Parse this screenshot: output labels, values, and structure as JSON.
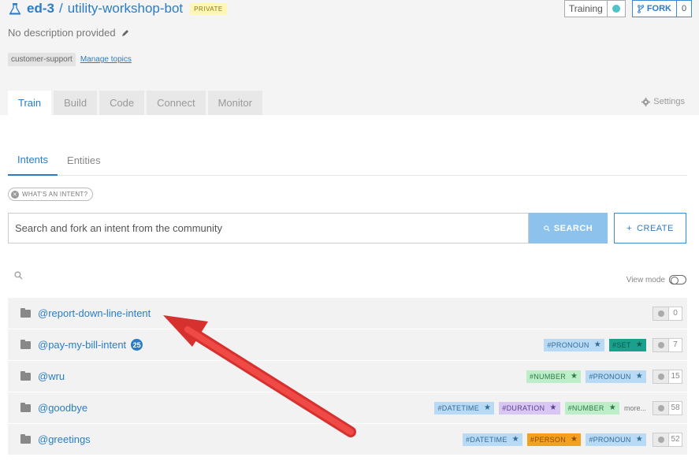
{
  "header": {
    "owner": "ed-3",
    "slash": "/",
    "repo": "utility-workshop-bot",
    "private_badge": "PRIVATE",
    "description": "No description provided",
    "topic": "customer-support",
    "manage_topics": "Manage topics",
    "training_label": "Training",
    "fork_label": "FORK",
    "fork_count": "0"
  },
  "tabs": [
    {
      "label": "Train",
      "active": true
    },
    {
      "label": "Build"
    },
    {
      "label": "Code"
    },
    {
      "label": "Connect"
    },
    {
      "label": "Monitor"
    }
  ],
  "settings_label": "Settings",
  "subtabs": [
    {
      "label": "Intents",
      "active": true
    },
    {
      "label": "Entities"
    }
  ],
  "help_pill": "WHAT'S AN INTENT?",
  "search": {
    "value": "Search and fork an intent from the community",
    "button": "SEARCH",
    "create": "CREATE"
  },
  "view_mode_label": "View mode",
  "intents": [
    {
      "name": "@report-down-line-intent",
      "badge": "",
      "tags": [],
      "more": "",
      "count": "0"
    },
    {
      "name": "@pay-my-bill-intent",
      "badge": "25",
      "tags": [
        {
          "text": "#PRONOUN",
          "color": "blue"
        },
        {
          "text": "#SET",
          "color": "teal"
        }
      ],
      "more": "",
      "count": "7"
    },
    {
      "name": "@wru",
      "badge": "",
      "tags": [
        {
          "text": "#NUMBER",
          "color": "green"
        },
        {
          "text": "#PRONOUN",
          "color": "blue"
        }
      ],
      "more": "",
      "count": "15"
    },
    {
      "name": "@goodbye",
      "badge": "",
      "tags": [
        {
          "text": "#DATETIME",
          "color": "blue"
        },
        {
          "text": "#DURATION",
          "color": "purple"
        },
        {
          "text": "#NUMBER",
          "color": "green"
        }
      ],
      "more": "more...",
      "count": "58"
    },
    {
      "name": "@greetings",
      "badge": "",
      "tags": [
        {
          "text": "#DATETIME",
          "color": "blue"
        },
        {
          "text": "#PERSON",
          "color": "orange"
        },
        {
          "text": "#PRONOUN",
          "color": "blue"
        }
      ],
      "more": "",
      "count": "52"
    }
  ],
  "colors": {
    "accent": "#2a7cc7",
    "arrow": "#e8393a",
    "search_button": "#8cc2ec"
  },
  "icons": [
    "bot-icon",
    "pencil-icon",
    "fork-icon",
    "gear-icon",
    "search-icon",
    "plus-icon",
    "folder-icon",
    "filter-icon",
    "comment-icon",
    "close-icon",
    "star-icon"
  ]
}
